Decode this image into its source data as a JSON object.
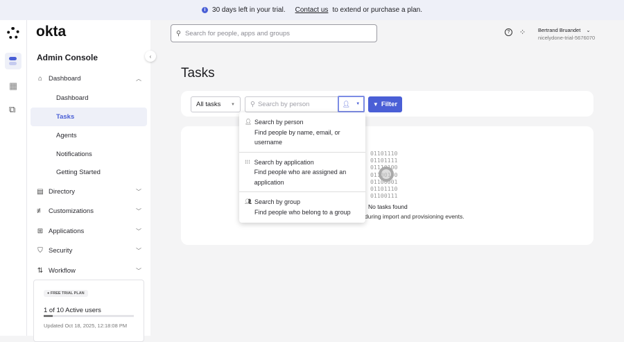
{
  "banner": {
    "message": "30 days left in your trial.",
    "link": "Contact us",
    "suffix": "to extend or purchase a plan."
  },
  "brand": {
    "logo": "okta",
    "console": "Admin Console"
  },
  "search": {
    "placeholder": "Search for people, apps and groups"
  },
  "user": {
    "name": "Bertrand Bruandet",
    "org": "nicelydone-trial-5676070"
  },
  "sidebar": {
    "dashboard": "Dashboard",
    "sub": [
      "Dashboard",
      "Tasks",
      "Agents",
      "Notifications",
      "Getting Started"
    ],
    "sections": [
      "Directory",
      "Customizations",
      "Applications",
      "Security",
      "Workflow"
    ]
  },
  "trial": {
    "badge": "FREE TRIAL PLAN",
    "users": "1 of 10 Active users",
    "progress": 0.1,
    "updated": "Updated Oct 18, 2025, 12:18:08 PM"
  },
  "page": {
    "title": "Tasks"
  },
  "toolbar": {
    "select": "All tasks",
    "search_placeholder": "Search by person",
    "filter": "Filter"
  },
  "dropdown": [
    {
      "title": "Search by person",
      "desc": "Find people by name, email, or username"
    },
    {
      "title": "Search by application",
      "desc": "Find people who are assigned an application"
    },
    {
      "title": "Search by group",
      "desc": "Find people who belong to a group"
    }
  ],
  "empty": {
    "binary": [
      "01101110",
      "01101111",
      "01110100",
      "01100100",
      "01100001",
      "01101110",
      "01100111"
    ],
    "title": "No tasks found",
    "desc": "during import and provisioning events."
  },
  "colors": {
    "accent": "#4a5fd6"
  }
}
